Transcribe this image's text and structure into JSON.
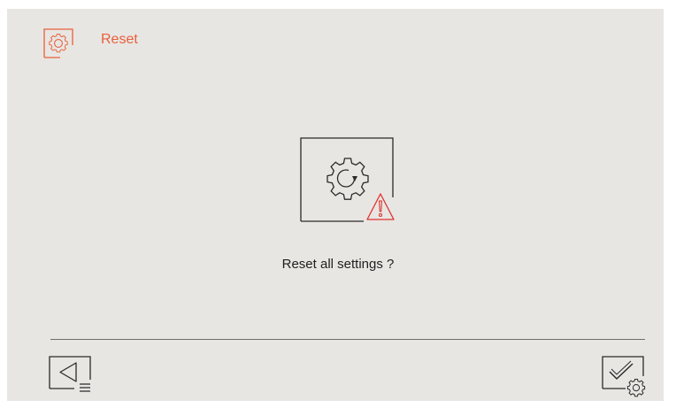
{
  "header": {
    "title": "Reset",
    "icon": "settings-gear-icon",
    "accent_color": "#e8603c"
  },
  "dialog": {
    "icon": "reset-settings-warning-icon",
    "message": "Reset all settings ?",
    "warning_color": "#e0322f"
  },
  "footer": {
    "back_icon": "back-menu-icon",
    "confirm_icon": "confirm-settings-icon"
  },
  "colors": {
    "background": "#e8e6e3",
    "text": "#1f1f1f",
    "line": "#6e6e6e"
  }
}
